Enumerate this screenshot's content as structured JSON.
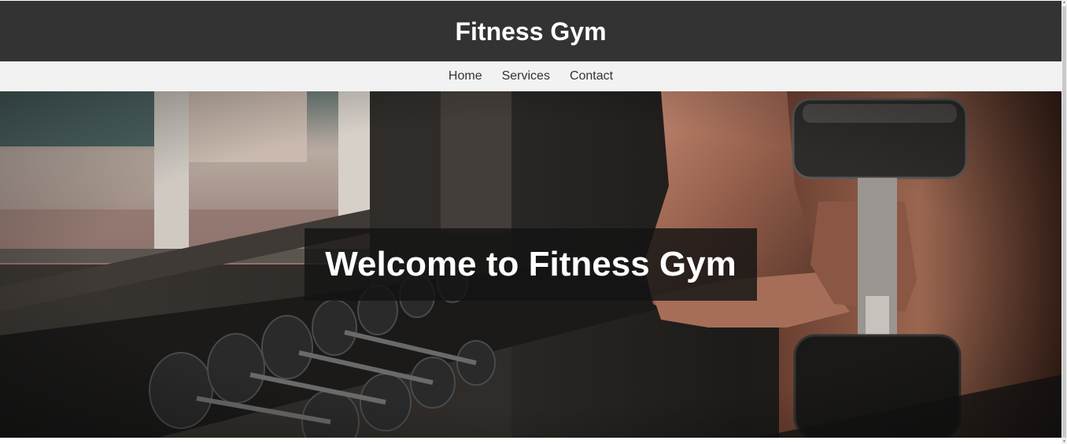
{
  "header": {
    "title": "Fitness Gym"
  },
  "nav": {
    "items": [
      {
        "label": "Home"
      },
      {
        "label": "Services"
      },
      {
        "label": "Contact"
      }
    ]
  },
  "hero": {
    "heading": "Welcome to Fitness Gym",
    "image_subject": "man-lifting-dumbbell-beside-rack-photo"
  },
  "colors": {
    "header_bg": "#333333",
    "nav_bg": "#f2f2f2",
    "text_light": "#ffffff",
    "text_dark": "#333333"
  }
}
